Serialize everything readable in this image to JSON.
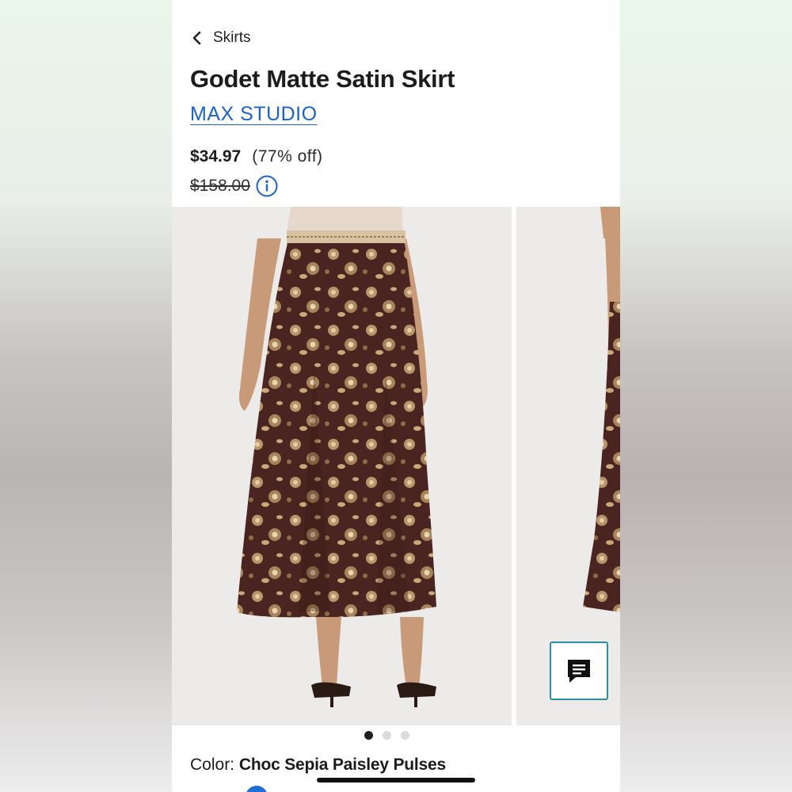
{
  "nav": {
    "back_label": "Skirts"
  },
  "product": {
    "title": "Godet Matte Satin Skirt",
    "brand": "MAX STUDIO",
    "price": "$34.97",
    "discount": "(77% off)",
    "original_price": "$158.00"
  },
  "gallery": {
    "image_count": 3,
    "active_index": 0
  },
  "color": {
    "label": "Color:",
    "value": "Choc Sepia Paisley Pulses"
  },
  "colors": {
    "brand_link": "#1b63c4",
    "chat_border": "#2b8fa0",
    "skirt": "#4a2420",
    "print": "#c9a87a"
  },
  "icons": {
    "back": "chevron-left-icon",
    "info": "info-icon",
    "chat": "chat-icon"
  }
}
